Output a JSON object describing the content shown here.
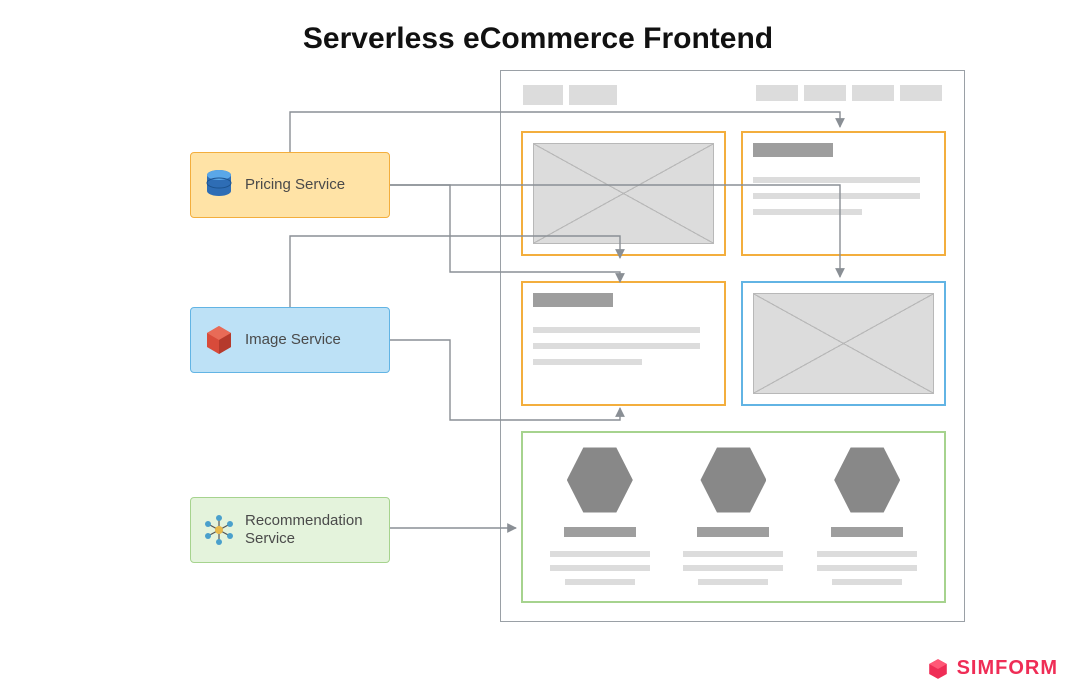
{
  "title": "Serverless eCommerce Frontend",
  "services": {
    "pricing": {
      "label": "Pricing Service",
      "icon": "database-icon",
      "color": "#ffe3a6",
      "border": "#f3ae3d"
    },
    "image": {
      "label": "Image Service",
      "icon": "cube-icon",
      "color": "#bde1f6",
      "border": "#62b4e4"
    },
    "recommendation": {
      "label": "Recommendation Service",
      "icon": "graph-icon",
      "color": "#e4f3dc",
      "border": "#a6d38e"
    }
  },
  "frame": {
    "header": {
      "logo_blocks": 2,
      "nav_blocks": 4
    },
    "cards": {
      "top_left": {
        "style": "image",
        "border": "orange"
      },
      "top_right": {
        "style": "text",
        "border": "orange"
      },
      "mid_left": {
        "style": "text",
        "border": "orange"
      },
      "mid_right": {
        "style": "image",
        "border": "blue"
      },
      "bottom": {
        "style": "icons",
        "border": "green",
        "items": 3
      }
    }
  },
  "brand": {
    "text": "SIMFORM",
    "color": "#ef2d56"
  },
  "connectors": [
    {
      "from": "pricing",
      "to": [
        "top_right",
        "mid_left",
        "mid_right"
      ]
    },
    {
      "from": "image",
      "to": [
        "top_left",
        "mid_left"
      ]
    },
    {
      "from": "recommendation",
      "to": [
        "bottom"
      ]
    }
  ]
}
